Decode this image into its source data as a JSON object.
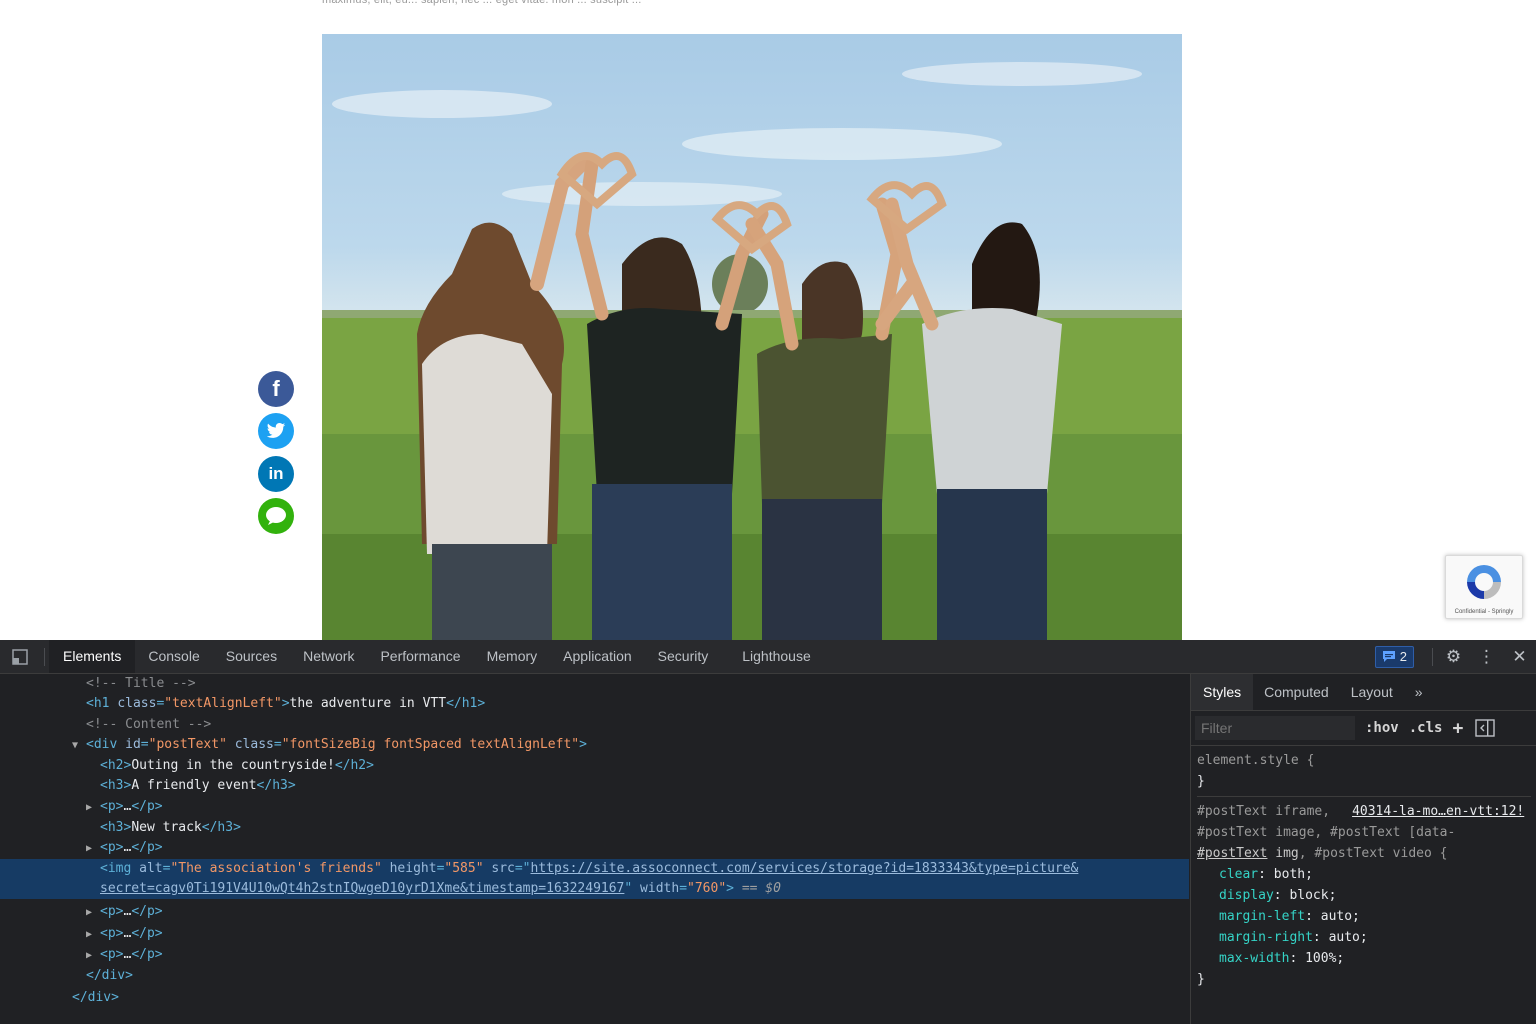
{
  "page": {
    "top_text": "maximus, elit, eu... sapien, nec ... eget vitae. mon ... suscipit ...",
    "photo_alt": "The association's friends",
    "share": {
      "facebook_glyph": "f",
      "linkedin_glyph": "in"
    },
    "recaptcha": {
      "footer": "Confidential - Springly"
    }
  },
  "devtools": {
    "tabs": [
      "Elements",
      "Console",
      "Sources",
      "Network",
      "Performance",
      "Memory",
      "Application",
      "Security",
      "Lighthouse"
    ],
    "active_tab": "Elements",
    "issues_count": "2",
    "dom": {
      "comment_title": "<!-- Title -->",
      "h1_class": "\"textAlignLeft\"",
      "h1_text": "the adventure in VTT",
      "comment_content": "<!-- Content -->",
      "div_id": "\"postText\"",
      "div_class": "\"fontSizeBig fontSpaced textAlignLeft\"",
      "h2_text": "Outing in the countryside!",
      "h3a_text": "A friendly event",
      "p_collapsed": "…",
      "h3b_text": "New track",
      "img_alt": "\"The association's friends\"",
      "img_height": "\"585\"",
      "img_src_1": "https://site.assoconnect.com/services/storage?id=1833343&type=picture&",
      "img_src_2": "secret=cagv0Ti191V4U10wQt4h2stnIQwgeD10yrD1Xme&timestamp=1632249167",
      "img_width": "\"760\"",
      "selected_marker": "== $0"
    },
    "styles": {
      "tabs": [
        "Styles",
        "Computed",
        "Layout"
      ],
      "more": "»",
      "filter_placeholder": "Filter",
      "hov": ":hov",
      "cls": ".cls",
      "element_style": "element.style {",
      "close_brace": "}",
      "rule_sel_1a": "#postText iframe,",
      "rule_source": "40314-la-mo…en-vtt:12!",
      "rule_sel_2": "#postText image, #postText [data-",
      "rule_sel_3a": "#postText",
      "rule_sel_3b": "img",
      "rule_sel_3c": ", #postText video {",
      "decls": [
        {
          "prop": "clear",
          "val": "both;"
        },
        {
          "prop": "display",
          "val": "block;"
        },
        {
          "prop": "margin-left",
          "val": "auto;"
        },
        {
          "prop": "margin-right",
          "val": "auto;"
        },
        {
          "prop": "max-width",
          "val": "100%;"
        }
      ]
    }
  }
}
